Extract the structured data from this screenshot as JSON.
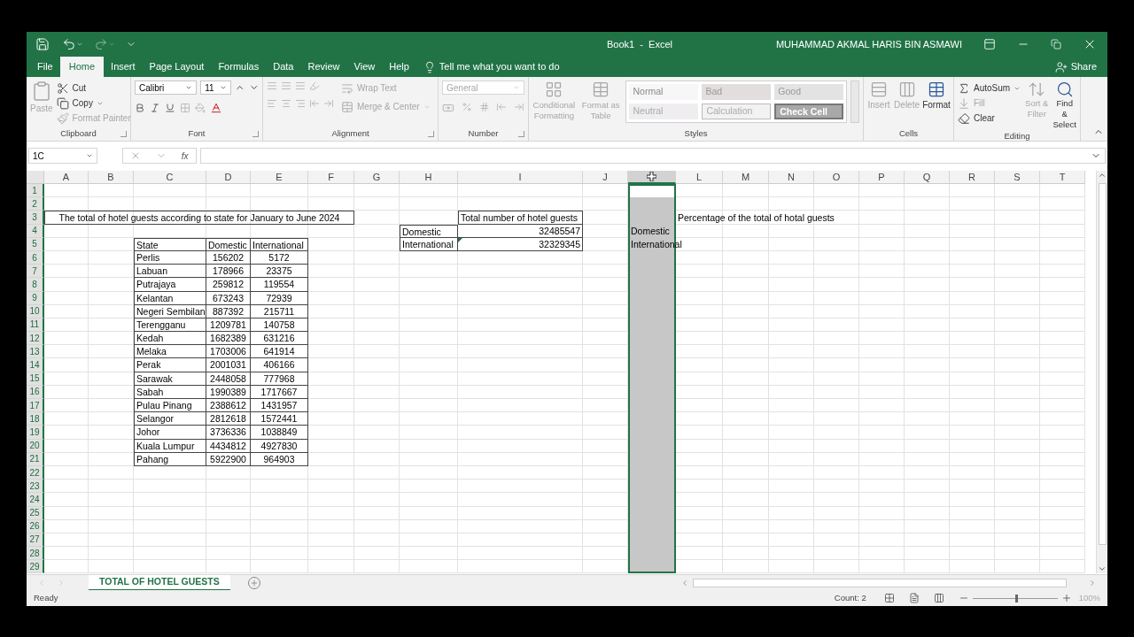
{
  "title_bar": {
    "title": "Book1  -  Excel",
    "user": "MUHAMMAD AKMAL HARIS BIN ASMAWI"
  },
  "menu_tabs": [
    {
      "label": "File",
      "selected": false
    },
    {
      "label": "Home",
      "selected": true
    },
    {
      "label": "Insert",
      "selected": false
    },
    {
      "label": "Page Layout",
      "selected": false
    },
    {
      "label": "Formulas",
      "selected": false
    },
    {
      "label": "Data",
      "selected": false
    },
    {
      "label": "Review",
      "selected": false
    },
    {
      "label": "View",
      "selected": false
    },
    {
      "label": "Help",
      "selected": false
    }
  ],
  "tell_me": {
    "placeholder": "Tell me what you want to do"
  },
  "share": "Share",
  "ribbon": {
    "clipboard": {
      "label": "Clipboard",
      "paste": {
        "label": "Paste",
        "disabled": true
      },
      "cut": {
        "label": "Cut",
        "disabled": false
      },
      "copy": {
        "label": "Copy",
        "disabled": false
      },
      "format_painter": {
        "label": "Format Painter",
        "disabled": true
      }
    },
    "font": {
      "label": "Font",
      "font_name": "Calibri",
      "font_size": "11"
    },
    "alignment": {
      "label": "Alignment",
      "wrap_text": {
        "label": "Wrap Text",
        "disabled": true
      },
      "merge_center": {
        "label": "Merge & Center",
        "disabled": true
      }
    },
    "number": {
      "label": "Number",
      "format": {
        "value": "General",
        "disabled": true
      }
    },
    "styles": {
      "label": "Styles",
      "conditional_formatting": {
        "label": "Conditional Formatting",
        "disabled": true
      },
      "format_as_table": {
        "label": "Format as Table",
        "disabled": true
      },
      "gallery": [
        {
          "label": "Normal",
          "kind": "normal"
        },
        {
          "label": "Bad",
          "kind": "bad"
        },
        {
          "label": "Good",
          "kind": "good"
        },
        {
          "label": "Neutral",
          "kind": "neutral"
        },
        {
          "label": "Calculation",
          "kind": "calculation"
        },
        {
          "label": "Check Cell",
          "kind": "check"
        }
      ]
    },
    "cells": {
      "label": "Cells",
      "buttons": [
        {
          "label": "Insert",
          "disabled": true
        },
        {
          "label": "Delete",
          "disabled": true
        },
        {
          "label": "Format",
          "disabled": false
        }
      ]
    },
    "editing": {
      "label": "Editing",
      "autosum": {
        "label": "AutoSum",
        "disabled": false
      },
      "fill": {
        "label": "Fill",
        "disabled": true
      },
      "clear": {
        "label": "Clear",
        "disabled": false
      },
      "sort_filter": {
        "label": "Sort & Filter",
        "disabled": true
      },
      "find_select": {
        "label": "Find & Select",
        "disabled": false
      }
    }
  },
  "formula_bar": {
    "name_box": "1C",
    "function_label": "fx"
  },
  "sheet": {
    "columns": [
      {
        "label": "A",
        "selected": false,
        "cursor": false
      },
      {
        "label": "B",
        "selected": false,
        "cursor": false
      },
      {
        "label": "C",
        "selected": false,
        "cursor": false
      },
      {
        "label": "D",
        "selected": false,
        "cursor": false
      },
      {
        "label": "E",
        "selected": false,
        "cursor": false
      },
      {
        "label": "F",
        "selected": false,
        "cursor": false
      },
      {
        "label": "G",
        "selected": false,
        "cursor": false
      },
      {
        "label": "H",
        "selected": false,
        "cursor": false
      },
      {
        "label": "I",
        "selected": false,
        "cursor": false
      },
      {
        "label": "J",
        "selected": false,
        "cursor": false
      },
      {
        "selected": true,
        "cursor": true
      },
      {
        "label": "L",
        "selected": false,
        "cursor": false
      },
      {
        "label": "M",
        "selected": false,
        "cursor": false
      },
      {
        "label": "N",
        "selected": false,
        "cursor": false
      },
      {
        "label": "O",
        "selected": false,
        "cursor": false
      },
      {
        "label": "P",
        "selected": false,
        "cursor": false
      },
      {
        "label": "Q",
        "selected": false,
        "cursor": false
      },
      {
        "label": "R",
        "selected": false,
        "cursor": false
      },
      {
        "label": "S",
        "selected": false,
        "cursor": false
      },
      {
        "label": "T",
        "selected": false,
        "cursor": false
      }
    ],
    "row_numbers": [
      "1",
      "2",
      "3",
      "4",
      "5",
      "6",
      "7",
      "8",
      "9",
      "10",
      "11",
      "12",
      "13",
      "14",
      "15",
      "16",
      "17",
      "18",
      "19",
      "20",
      "21",
      "22",
      "23",
      "24",
      "25",
      "26",
      "27",
      "28",
      "29"
    ],
    "title": "The total of hotel guests according to state for January to June 2024",
    "state_table": {
      "columns": [
        "State",
        "Domestic",
        "International"
      ],
      "rows": [
        [
          "Perlis",
          "156202",
          "5172"
        ],
        [
          "Labuan",
          "178966",
          "23375"
        ],
        [
          "Putrajaya",
          "259812",
          "119554"
        ],
        [
          "Kelantan",
          "673243",
          "72939"
        ],
        [
          "Negeri Sembilan",
          "887392",
          "215711"
        ],
        [
          "Terengganu",
          "1209781",
          "140758"
        ],
        [
          "Kedah",
          "1682389",
          "631216"
        ],
        [
          "Melaka",
          "1703006",
          "641914"
        ],
        [
          "Perak",
          "2001031",
          "406166"
        ],
        [
          "Sarawak",
          "2448058",
          "777968"
        ],
        [
          "Sabah",
          "1990389",
          "1717667"
        ],
        [
          "Pulau Pinang",
          "2388612",
          "1431957"
        ],
        [
          "Selangor",
          "2812618",
          "1572441"
        ],
        [
          "Johor",
          "3736336",
          "1038849"
        ],
        [
          "Kuala Lumpur",
          "4434812",
          "4927830"
        ],
        [
          "Pahang",
          "5922900",
          "964903"
        ]
      ]
    },
    "totals_table": {
      "header": "Total number of hotel guests",
      "rows": [
        {
          "label": "Domestic",
          "value": "32485547",
          "flagged": false
        },
        {
          "label": "International",
          "value": "32329345",
          "flagged": true
        }
      ]
    },
    "column_k_labels": [
      "Domestic",
      "International"
    ],
    "percentage_title": "Percentage of the total of hotal guests"
  },
  "sheet_tabs": [
    {
      "label": "TOTAL OF HOTEL GUESTS",
      "selected": true
    }
  ],
  "status_bar": {
    "status": "Ready",
    "count": "Count: 2",
    "zoom": {
      "level": 0.5,
      "reading": "100%"
    }
  }
}
